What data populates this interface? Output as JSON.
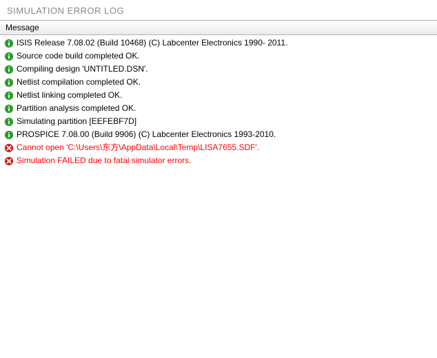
{
  "window": {
    "title": "SIMULATION ERROR LOG"
  },
  "header": {
    "column_label": "Message"
  },
  "icons": {
    "info_bg": "#2e9b2e",
    "error_bg": "#d62020"
  },
  "log": {
    "rows": [
      {
        "type": "info",
        "text": "ISIS Release 7.08.02 (Build 10468) (C) Labcenter Electronics 1990- 2011."
      },
      {
        "type": "info",
        "text": "Source code build completed OK."
      },
      {
        "type": "info",
        "text": "Compiling design 'UNTITLED.DSN'."
      },
      {
        "type": "info",
        "text": "Netlist compilation completed OK."
      },
      {
        "type": "info",
        "text": "Netlist linking completed OK."
      },
      {
        "type": "info",
        "text": "Partition analysis completed OK."
      },
      {
        "type": "info",
        "text": "Simulating partition [EEFEBF7D]"
      },
      {
        "type": "info",
        "text": "PROSPICE 7.08.00 (Build 9906) (C) Labcenter Electronics 1993-2010."
      },
      {
        "type": "error",
        "text": "Cannot open 'C:\\Users\\东方\\AppData\\Local\\Temp\\LISA7655.SDF'."
      },
      {
        "type": "error",
        "text": "Simulation FAILED due to fatal simulator errors."
      }
    ]
  }
}
